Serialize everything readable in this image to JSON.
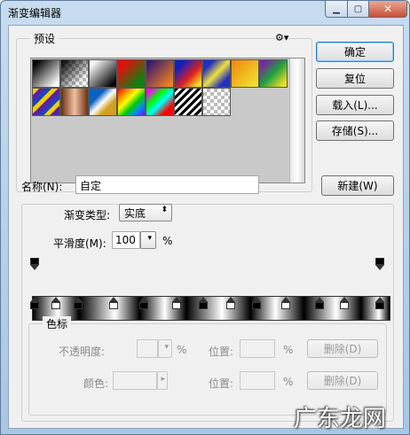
{
  "window": {
    "title": "渐变编辑器",
    "minimize_glyph": "▁",
    "maximize_glyph": "▢",
    "close_glyph": "✕"
  },
  "presets": {
    "legend": "预设",
    "menu_glyph": "⚙▾"
  },
  "buttons": {
    "ok": "确定",
    "reset": "复位",
    "load": "载入(L)...",
    "save": "存储(S)...",
    "new": "新建(W)"
  },
  "name_field": {
    "label": "名称(N):",
    "value": "自定"
  },
  "gradient_type": {
    "label": "渐变类型:",
    "value": "实底"
  },
  "smoothness": {
    "label": "平滑度(M):",
    "value": "100",
    "unit": "%"
  },
  "color_stops_group": {
    "legend": "色标",
    "opacity_label": "不透明度:",
    "opacity_unit": "%",
    "position_label_1": "位置:",
    "position_unit_1": "%",
    "delete_label_1": "删除(D)",
    "color_label": "颜色:",
    "position_label_2": "位置:",
    "position_unit_2": "%",
    "delete_label_2": "删除(D)"
  },
  "watermark": {
    "text": "广东龙网"
  },
  "colors": {
    "stop_black": "#000000",
    "stop_white": "#ffffff"
  },
  "color_stops": [
    "black",
    "white",
    "black",
    "white",
    "black",
    "white",
    "black",
    "white",
    "black",
    "white",
    "black",
    "white",
    "black"
  ]
}
